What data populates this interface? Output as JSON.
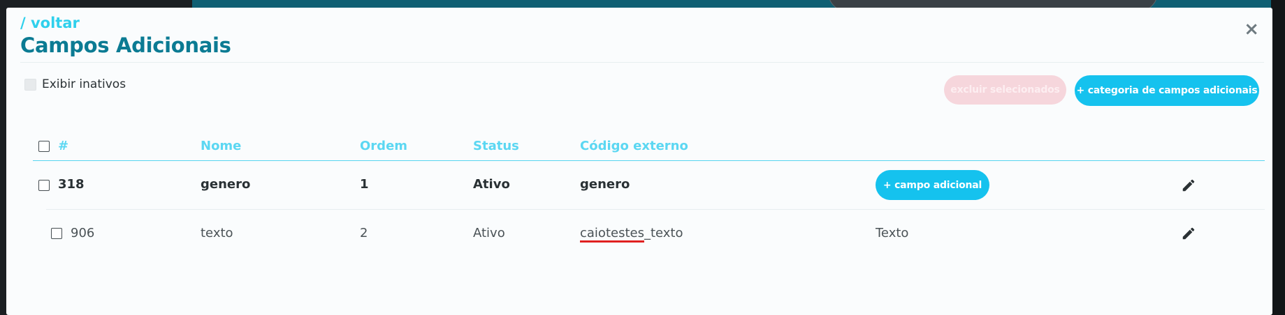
{
  "header": {
    "back_link": "/ voltar",
    "title": "Campos Adicionais",
    "close_label": "×"
  },
  "filters": {
    "show_inactive_label": "Exibir inativos"
  },
  "toolbar": {
    "delete_selected_label": "excluir selecionados",
    "add_category_label": "+ categoria de campos adicionais"
  },
  "table": {
    "columns": [
      "#",
      "Nome",
      "Ordem",
      "Status",
      "Código externo"
    ],
    "category_row": {
      "id": "318",
      "name": "genero",
      "order": "1",
      "status": "Ativo",
      "external_code": "genero",
      "add_field_label": "+ campo adicional"
    },
    "field_row": {
      "id": "906",
      "name": "texto",
      "order": "2",
      "status": "Ativo",
      "external_code_a": "caiotestes",
      "external_code_b": "_texto",
      "type": "Texto"
    }
  },
  "colors": {
    "accent": "#15c2ee",
    "title": "#0b7b93",
    "header_text": "#5bd7f2",
    "danger_disabled": "#f6d6dc"
  },
  "icons": [
    "close-icon",
    "pencil-icon"
  ]
}
